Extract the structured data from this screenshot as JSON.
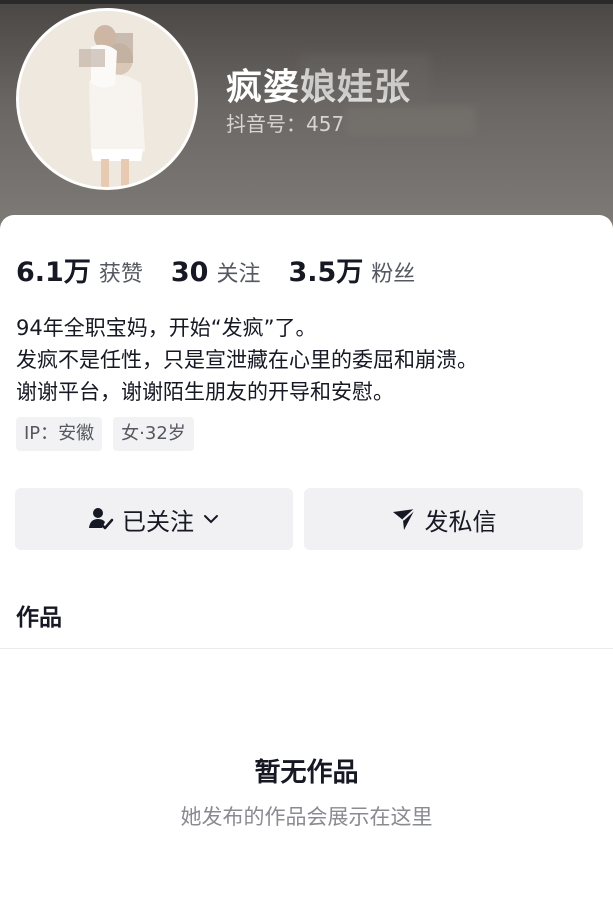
{
  "profile": {
    "nickname": "疯婆娘娃张",
    "douyin_id": "抖音号：457",
    "stats": [
      {
        "value": "6.1万",
        "label": "获赞"
      },
      {
        "value": "30",
        "label": "关注"
      },
      {
        "value": "3.5万",
        "label": "粉丝"
      }
    ],
    "bio": [
      "94年全职宝妈，开始“发疯”了。",
      "发疯不是任性，只是宣泄藏在心里的委屈和崩溃。",
      "谢谢平台，谢谢陌生朋友的开导和安慰。"
    ],
    "tags": [
      "IP：安徽",
      "女·32岁"
    ]
  },
  "actions": {
    "follow_label": "已关注",
    "message_label": "发私信"
  },
  "tabs": {
    "works_label": "作品"
  },
  "empty_state": {
    "title": "暂无作品",
    "subtitle": "她发布的作品会展示在这里"
  },
  "colors": {
    "header_bg": "#6b6764",
    "text_primary": "#161823",
    "text_secondary": "#555860",
    "button_bg": "#f1f1f3"
  }
}
